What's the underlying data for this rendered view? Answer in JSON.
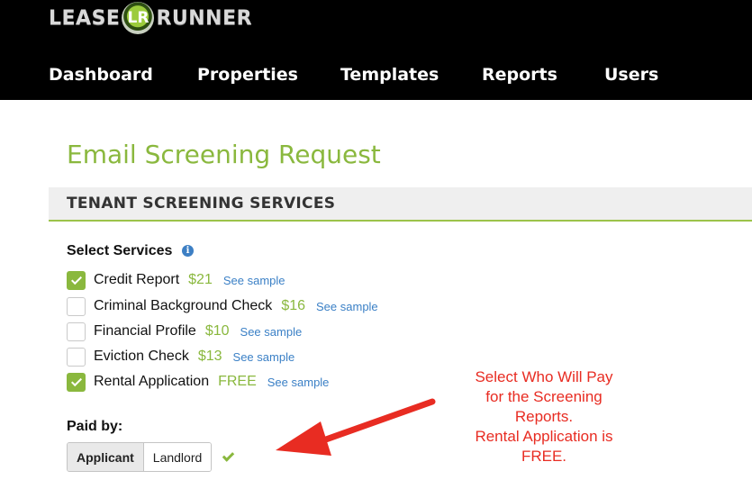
{
  "header": {
    "logo": {
      "left": "LEASE",
      "mark": "LR",
      "right": "RUNNER"
    },
    "nav": [
      {
        "label": "Dashboard"
      },
      {
        "label": "Properties"
      },
      {
        "label": "Templates"
      },
      {
        "label": "Reports"
      },
      {
        "label": "Users"
      }
    ]
  },
  "main": {
    "title": "Email Screening Request",
    "section_title": "TENANT SCREENING SERVICES",
    "select_services_label": "Select Services",
    "services": [
      {
        "name": "Credit Report",
        "price": "$21",
        "link": "See sample",
        "checked": true
      },
      {
        "name": "Criminal Background Check",
        "price": "$16",
        "link": "See sample",
        "checked": false
      },
      {
        "name": "Financial Profile",
        "price": "$10",
        "link": "See sample",
        "checked": false
      },
      {
        "name": "Eviction Check",
        "price": "$13",
        "link": "See sample",
        "checked": false
      },
      {
        "name": "Rental Application",
        "price": "FREE",
        "link": "See sample",
        "checked": true
      }
    ],
    "paid_by_label": "Paid by:",
    "paid_by_options": [
      "Applicant",
      "Landlord"
    ],
    "paid_by_selected": "Applicant"
  },
  "annotation": {
    "lines": [
      "Select Who Will Pay",
      "for the Screening",
      "Reports.",
      "Rental Application is",
      "FREE."
    ],
    "color": "#e82c22"
  },
  "colors": {
    "accent_green": "#8ab83e",
    "link_blue": "#3b80c6",
    "header_bg": "#000000"
  }
}
